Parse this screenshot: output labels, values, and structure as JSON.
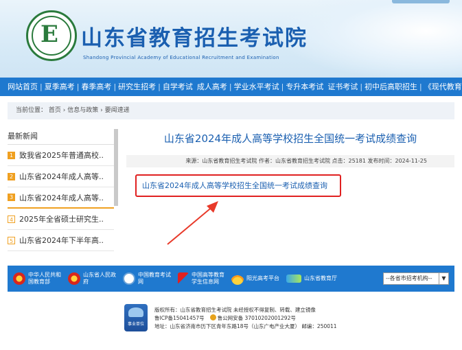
{
  "header": {
    "title_cn": "山东省教育招生考试院",
    "title_en": "Shandong Provincial Academy of Educational Recruitment and Examination"
  },
  "nav": {
    "items": [
      {
        "label": "网站首页"
      },
      {
        "label": "夏季高考"
      },
      {
        "label": "春季高考"
      },
      {
        "label": "研究生招考"
      },
      {
        "label": "自学考试"
      },
      {
        "label": "成人高考"
      },
      {
        "label": "学业水平考试"
      },
      {
        "label": "专升本考试"
      },
      {
        "label": "证书考试"
      },
      {
        "label": "初中后高职招生"
      },
      {
        "label": "《现代教育》"
      }
    ]
  },
  "breadcrumb": {
    "prefix": "当前位置：",
    "home": "首页",
    "section": "信息与政策",
    "current": "要闻速递",
    "arrow": "›"
  },
  "sidebar": {
    "title": "最新新闻",
    "items": [
      {
        "num": "1",
        "label": "致我省2025年普通高校.."
      },
      {
        "num": "2",
        "label": "山东省2024年成人高等.."
      },
      {
        "num": "3",
        "label": "山东省2024年成人高等.."
      },
      {
        "num": "4",
        "label": "2025年全省硕士研究生.."
      },
      {
        "num": "5",
        "label": "山东省2024年下半年高.."
      }
    ]
  },
  "article": {
    "title": "山东省2024年成人高等学校招生全国统一考试成绩查询",
    "meta": "来源：山东省教育招生考试院 作者：山东省教育招生考试院 点击：25181 发布时间：2024-11-25",
    "link_text": "山东省2024年成人高等学校招生全国统一考试成绩查询"
  },
  "footer_links": [
    {
      "label1": "中华人民共和",
      "label2": "国教育部",
      "icon": "emblem-icon"
    },
    {
      "label1": "山东省人民政",
      "label2": "府",
      "icon": "emblem-icon"
    },
    {
      "label1": "中国教育考试",
      "label2": "网",
      "icon": "exam-net-icon"
    },
    {
      "label1": "中国高等教育",
      "label2": "学生信息网",
      "icon": "chsi-icon"
    },
    {
      "label1": "阳光高考平台",
      "label2": "",
      "icon": "sun-icon"
    },
    {
      "label1": "山东省教育厅",
      "label2": "",
      "icon": "edu-dept-icon"
    }
  ],
  "footer_select": {
    "value": "--各省市招考机构--"
  },
  "copyright": {
    "line1": "版权所有：山东省教育招生考试院 未经授权不得复制、转载、建立镜像",
    "icp": "鲁ICP备15041457号",
    "police": "鲁公网安备 37010202001292号",
    "address": "地址：山东省济南市历下区青年东路18号（山东广电产业大厦） 邮编：250011",
    "badge": "事业单位"
  }
}
